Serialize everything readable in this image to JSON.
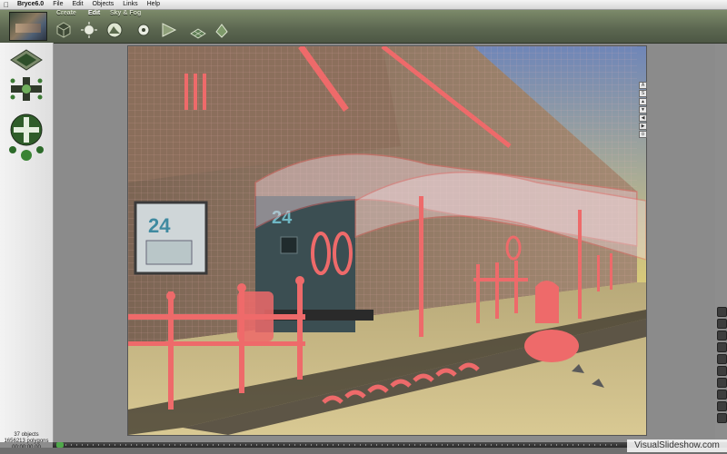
{
  "menubar": {
    "app_name": "Bryce6.0",
    "items": [
      "File",
      "Edit",
      "Objects",
      "Links",
      "Help"
    ]
  },
  "toolbar": {
    "tabs": [
      "Create",
      "Edit",
      "Sky & Fog"
    ],
    "active_tab": "Edit",
    "tools": [
      "cube-icon",
      "light-icon",
      "terrain-icon",
      "gear-icon",
      "pyramid-icon",
      "grid-icon",
      "leaf-icon"
    ]
  },
  "status": {
    "objects": "37 objects",
    "polygons": "1656213 polygons",
    "time": "00:00:00.00"
  },
  "nano_controls": [
    "A",
    "S",
    "▲",
    "▼",
    "◀",
    "▶",
    "⊙"
  ],
  "watermark": "VisualSlideshow.com",
  "scene": {
    "signs": [
      "24",
      "24"
    ],
    "colors": {
      "wireframe": "#ee6a6a",
      "sky": "#6f86b8",
      "ground": "#c9b98a"
    }
  }
}
